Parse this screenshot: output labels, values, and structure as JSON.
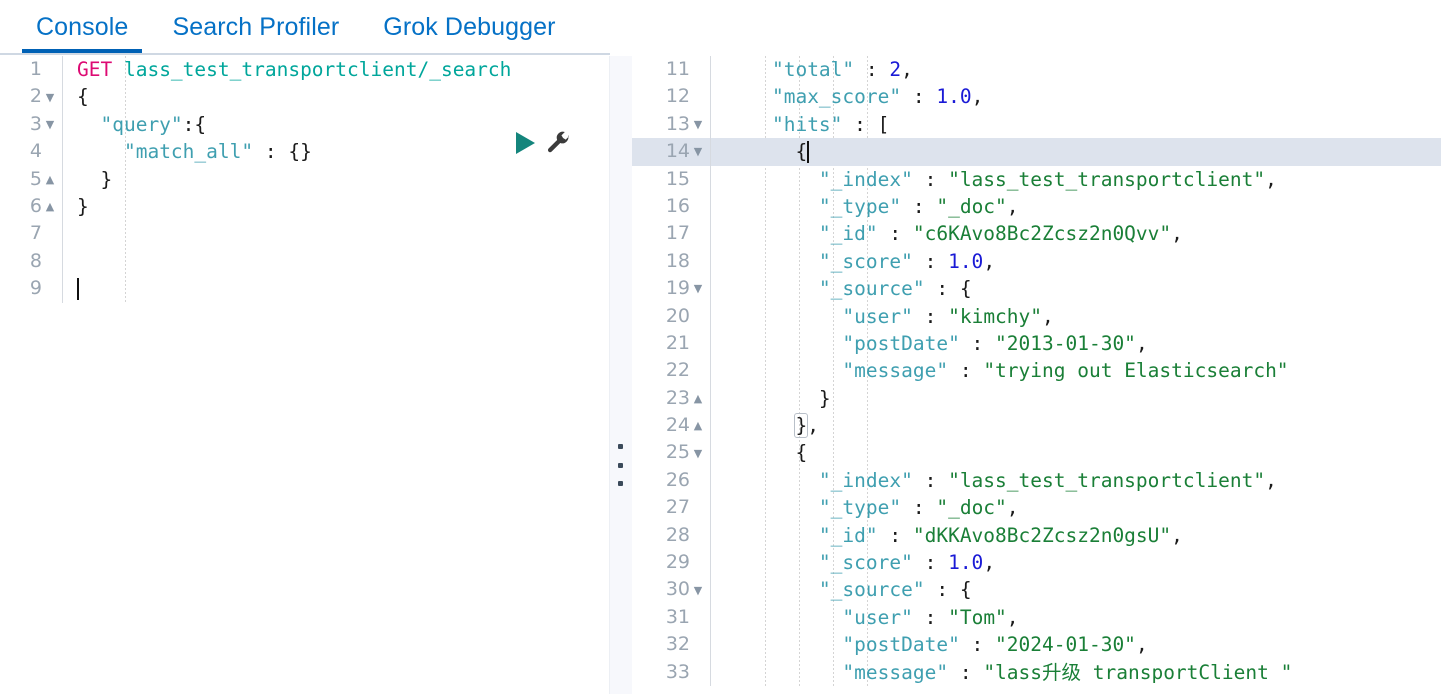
{
  "tabs": [
    {
      "label": "Console",
      "active": true
    },
    {
      "label": "Search Profiler",
      "active": false
    },
    {
      "label": "Grok Debugger",
      "active": false
    }
  ],
  "accent_color": "#0061b5",
  "tab_text_color": "#0571c6",
  "actions": {
    "run_icon": "play-triangle-icon",
    "run_label": "Send request",
    "wrench_icon": "wrench-icon",
    "wrench_label": "Open documentation / auto indent"
  },
  "request_editor": {
    "name": "console-request-editor",
    "active_line": 9,
    "cursor_line": 9,
    "lines": [
      {
        "n": 1,
        "fold": "",
        "tokens": [
          {
            "t": "GET ",
            "c": "k-method"
          },
          {
            "t": "lass_test_transportclient/_search",
            "c": "k-url"
          }
        ]
      },
      {
        "n": 2,
        "fold": "down",
        "tokens": [
          {
            "t": "{",
            "c": "k-brace"
          }
        ]
      },
      {
        "n": 3,
        "fold": "down",
        "tokens": [
          {
            "t": "  ",
            "c": "k-punc"
          },
          {
            "t": "\"query\"",
            "c": "k-key"
          },
          {
            "t": ":",
            "c": "k-punc"
          },
          {
            "t": "{",
            "c": "k-brace"
          }
        ]
      },
      {
        "n": 4,
        "fold": "",
        "tokens": [
          {
            "t": "    ",
            "c": "k-punc"
          },
          {
            "t": "\"match_all\"",
            "c": "k-key"
          },
          {
            "t": " : ",
            "c": "k-punc"
          },
          {
            "t": "{}",
            "c": "k-brace"
          }
        ]
      },
      {
        "n": 5,
        "fold": "up",
        "tokens": [
          {
            "t": "  ",
            "c": "k-punc"
          },
          {
            "t": "}",
            "c": "k-brace"
          }
        ]
      },
      {
        "n": 6,
        "fold": "up",
        "tokens": [
          {
            "t": "}",
            "c": "k-brace"
          }
        ]
      },
      {
        "n": 7,
        "fold": "",
        "tokens": []
      },
      {
        "n": 8,
        "fold": "",
        "tokens": []
      },
      {
        "n": 9,
        "fold": "",
        "tokens": []
      }
    ],
    "indent_guides": [
      48
    ]
  },
  "response_editor": {
    "name": "console-response-viewer",
    "active_line": 14,
    "first_visible_line": 11,
    "lines": [
      {
        "n": 11,
        "fold": "",
        "tokens": [
          {
            "t": "    ",
            "c": "k-punc"
          },
          {
            "t": "\"total\"",
            "c": "k-key"
          },
          {
            "t": " : ",
            "c": "k-punc"
          },
          {
            "t": "2",
            "c": "k-num"
          },
          {
            "t": ",",
            "c": "k-punc"
          }
        ]
      },
      {
        "n": 12,
        "fold": "",
        "tokens": [
          {
            "t": "    ",
            "c": "k-punc"
          },
          {
            "t": "\"max_score\"",
            "c": "k-key"
          },
          {
            "t": " : ",
            "c": "k-punc"
          },
          {
            "t": "1.0",
            "c": "k-num"
          },
          {
            "t": ",",
            "c": "k-punc"
          }
        ]
      },
      {
        "n": 13,
        "fold": "down",
        "tokens": [
          {
            "t": "    ",
            "c": "k-punc"
          },
          {
            "t": "\"hits\"",
            "c": "k-key"
          },
          {
            "t": " : ",
            "c": "k-punc"
          },
          {
            "t": "[",
            "c": "k-brace"
          }
        ]
      },
      {
        "n": 14,
        "fold": "down",
        "active": true,
        "caret": true,
        "tokens": [
          {
            "t": "      ",
            "c": "k-punc"
          },
          {
            "t": "{",
            "c": "k-brace"
          }
        ]
      },
      {
        "n": 15,
        "fold": "",
        "tokens": [
          {
            "t": "        ",
            "c": "k-punc"
          },
          {
            "t": "\"_index\"",
            "c": "k-key"
          },
          {
            "t": " : ",
            "c": "k-punc"
          },
          {
            "t": "\"lass_test_transportclient\"",
            "c": "k-str"
          },
          {
            "t": ",",
            "c": "k-punc"
          }
        ]
      },
      {
        "n": 16,
        "fold": "",
        "tokens": [
          {
            "t": "        ",
            "c": "k-punc"
          },
          {
            "t": "\"_type\"",
            "c": "k-key"
          },
          {
            "t": " : ",
            "c": "k-punc"
          },
          {
            "t": "\"_doc\"",
            "c": "k-str"
          },
          {
            "t": ",",
            "c": "k-punc"
          }
        ]
      },
      {
        "n": 17,
        "fold": "",
        "tokens": [
          {
            "t": "        ",
            "c": "k-punc"
          },
          {
            "t": "\"_id\"",
            "c": "k-key"
          },
          {
            "t": " : ",
            "c": "k-punc"
          },
          {
            "t": "\"c6KAvo8Bc2Zcsz2n0Qvv\"",
            "c": "k-str"
          },
          {
            "t": ",",
            "c": "k-punc"
          }
        ]
      },
      {
        "n": 18,
        "fold": "",
        "tokens": [
          {
            "t": "        ",
            "c": "k-punc"
          },
          {
            "t": "\"_score\"",
            "c": "k-key"
          },
          {
            "t": " : ",
            "c": "k-punc"
          },
          {
            "t": "1.0",
            "c": "k-num"
          },
          {
            "t": ",",
            "c": "k-punc"
          }
        ]
      },
      {
        "n": 19,
        "fold": "down",
        "tokens": [
          {
            "t": "        ",
            "c": "k-punc"
          },
          {
            "t": "\"_source\"",
            "c": "k-key"
          },
          {
            "t": " : ",
            "c": "k-punc"
          },
          {
            "t": "{",
            "c": "k-brace"
          }
        ]
      },
      {
        "n": 20,
        "fold": "",
        "tokens": [
          {
            "t": "          ",
            "c": "k-punc"
          },
          {
            "t": "\"user\"",
            "c": "k-key"
          },
          {
            "t": " : ",
            "c": "k-punc"
          },
          {
            "t": "\"kimchy\"",
            "c": "k-str"
          },
          {
            "t": ",",
            "c": "k-punc"
          }
        ]
      },
      {
        "n": 21,
        "fold": "",
        "tokens": [
          {
            "t": "          ",
            "c": "k-punc"
          },
          {
            "t": "\"postDate\"",
            "c": "k-key"
          },
          {
            "t": " : ",
            "c": "k-punc"
          },
          {
            "t": "\"2013-01-30\"",
            "c": "k-str"
          },
          {
            "t": ",",
            "c": "k-punc"
          }
        ]
      },
      {
        "n": 22,
        "fold": "",
        "tokens": [
          {
            "t": "          ",
            "c": "k-punc"
          },
          {
            "t": "\"message\"",
            "c": "k-key"
          },
          {
            "t": " : ",
            "c": "k-punc"
          },
          {
            "t": "\"trying out Elasticsearch\"",
            "c": "k-str"
          }
        ]
      },
      {
        "n": 23,
        "fold": "up",
        "tokens": [
          {
            "t": "        ",
            "c": "k-punc"
          },
          {
            "t": "}",
            "c": "k-brace"
          }
        ]
      },
      {
        "n": 24,
        "fold": "up",
        "tokens": [
          {
            "t": "      ",
            "c": "k-punc"
          },
          {
            "t": "}",
            "c": "k-brace brmatch"
          },
          {
            "t": ",",
            "c": "k-punc"
          }
        ]
      },
      {
        "n": 25,
        "fold": "down",
        "tokens": [
          {
            "t": "      ",
            "c": "k-punc"
          },
          {
            "t": "{",
            "c": "k-brace"
          }
        ]
      },
      {
        "n": 26,
        "fold": "",
        "tokens": [
          {
            "t": "        ",
            "c": "k-punc"
          },
          {
            "t": "\"_index\"",
            "c": "k-key"
          },
          {
            "t": " : ",
            "c": "k-punc"
          },
          {
            "t": "\"lass_test_transportclient\"",
            "c": "k-str"
          },
          {
            "t": ",",
            "c": "k-punc"
          }
        ]
      },
      {
        "n": 27,
        "fold": "",
        "tokens": [
          {
            "t": "        ",
            "c": "k-punc"
          },
          {
            "t": "\"_type\"",
            "c": "k-key"
          },
          {
            "t": " : ",
            "c": "k-punc"
          },
          {
            "t": "\"_doc\"",
            "c": "k-str"
          },
          {
            "t": ",",
            "c": "k-punc"
          }
        ]
      },
      {
        "n": 28,
        "fold": "",
        "tokens": [
          {
            "t": "        ",
            "c": "k-punc"
          },
          {
            "t": "\"_id\"",
            "c": "k-key"
          },
          {
            "t": " : ",
            "c": "k-punc"
          },
          {
            "t": "\"dKKAvo8Bc2Zcsz2n0gsU\"",
            "c": "k-str"
          },
          {
            "t": ",",
            "c": "k-punc"
          }
        ]
      },
      {
        "n": 29,
        "fold": "",
        "tokens": [
          {
            "t": "        ",
            "c": "k-punc"
          },
          {
            "t": "\"_score\"",
            "c": "k-key"
          },
          {
            "t": " : ",
            "c": "k-punc"
          },
          {
            "t": "1.0",
            "c": "k-num"
          },
          {
            "t": ",",
            "c": "k-punc"
          }
        ]
      },
      {
        "n": 30,
        "fold": "down",
        "tokens": [
          {
            "t": "        ",
            "c": "k-punc"
          },
          {
            "t": "\"_source\"",
            "c": "k-key"
          },
          {
            "t": " : ",
            "c": "k-punc"
          },
          {
            "t": "{",
            "c": "k-brace"
          }
        ]
      },
      {
        "n": 31,
        "fold": "",
        "tokens": [
          {
            "t": "          ",
            "c": "k-punc"
          },
          {
            "t": "\"user\"",
            "c": "k-key"
          },
          {
            "t": " : ",
            "c": "k-punc"
          },
          {
            "t": "\"Tom\"",
            "c": "k-str"
          },
          {
            "t": ",",
            "c": "k-punc"
          }
        ]
      },
      {
        "n": 32,
        "fold": "",
        "tokens": [
          {
            "t": "          ",
            "c": "k-punc"
          },
          {
            "t": "\"postDate\"",
            "c": "k-key"
          },
          {
            "t": " : ",
            "c": "k-punc"
          },
          {
            "t": "\"2024-01-30\"",
            "c": "k-str"
          },
          {
            "t": ",",
            "c": "k-punc"
          }
        ]
      },
      {
        "n": 33,
        "fold": "",
        "tokens": [
          {
            "t": "          ",
            "c": "k-punc"
          },
          {
            "t": "\"message\"",
            "c": "k-key"
          },
          {
            "t": " : ",
            "c": "k-punc"
          },
          {
            "t": "\"lass升级 transportClient \"",
            "c": "k-str"
          }
        ]
      }
    ],
    "indent_guides": [
      40,
      74,
      108,
      142
    ]
  },
  "resizer": {
    "name": "pane-resizer-grip",
    "dots": 3
  }
}
